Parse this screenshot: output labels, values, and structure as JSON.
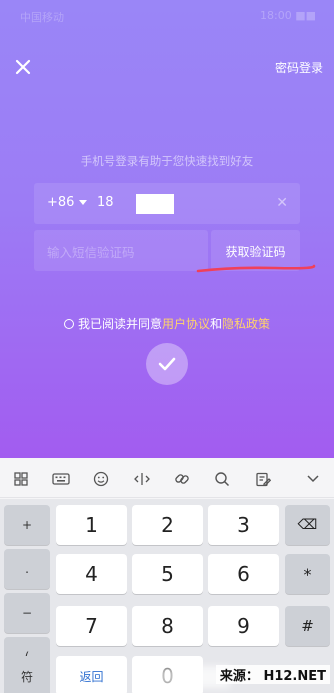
{
  "status_bar": {
    "carrier": "中国移动",
    "right": "18:00 ■■"
  },
  "header": {
    "password_login": "密码登录"
  },
  "form": {
    "hint": "手机号登录有助于您快速找到好友",
    "country_code": "+86",
    "phone_prefix": "18",
    "clear_glyph": "✕",
    "code_placeholder": "输入短信验证码",
    "get_code": "获取验证码"
  },
  "agreement": {
    "prefix": "我已阅读并同意",
    "user_agreement": "用户协议",
    "and": "和",
    "privacy_policy": "隐私政策"
  },
  "colors": {
    "accent_link": "#ffd36b",
    "annotation_underline": "#f0405a"
  },
  "keyboard": {
    "side_left": [
      "+",
      ".",
      "−",
      "("
    ],
    "digits": [
      "1",
      "2",
      "3",
      "4",
      "5",
      "6",
      "7",
      "8",
      "9"
    ],
    "right_keys": [
      "⌫",
      "*",
      "#"
    ],
    "bottom": {
      "symbol": "符",
      "back": "返回",
      "zero": "0"
    }
  },
  "watermark": "来源： H12.NET"
}
